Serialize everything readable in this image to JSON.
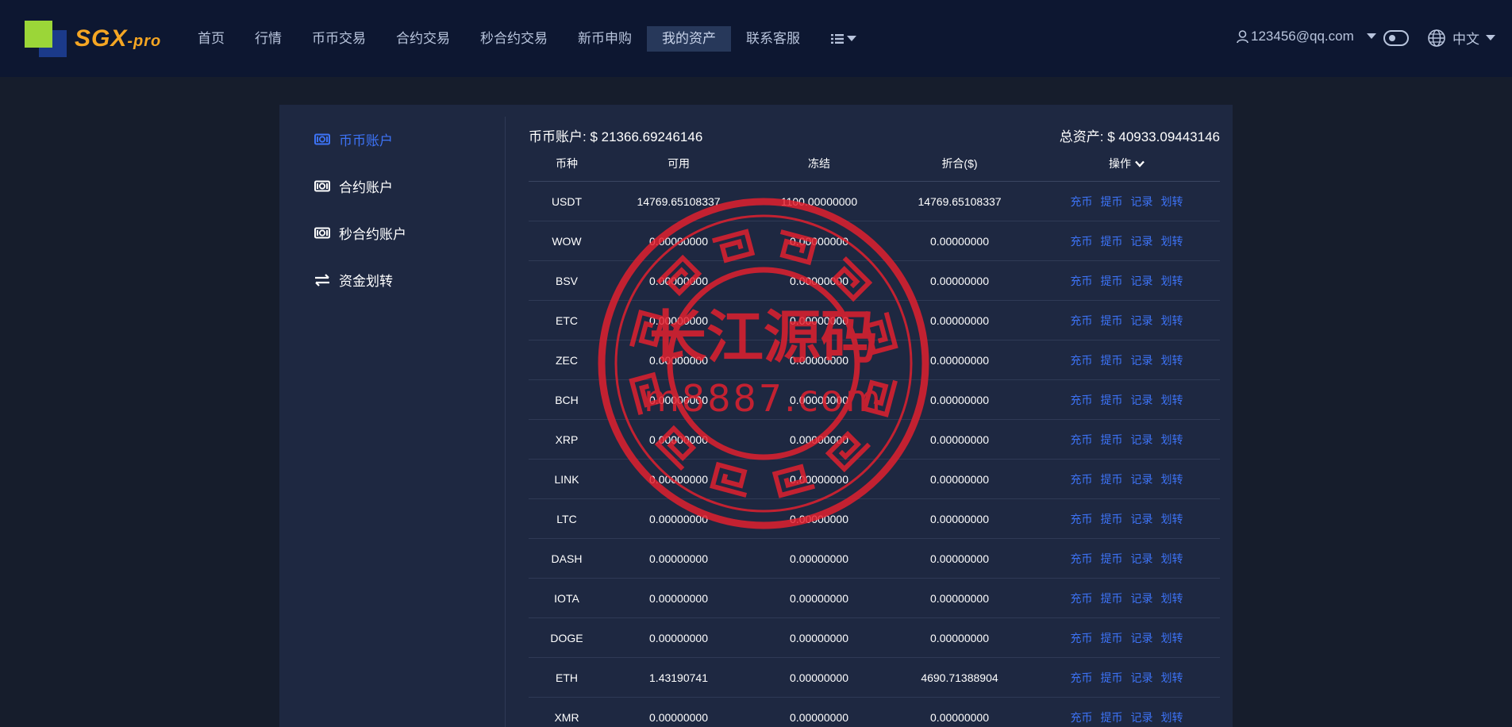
{
  "brand": {
    "logo_text": "SGX",
    "logo_suffix": "-pro"
  },
  "nav": [
    {
      "label": "首页"
    },
    {
      "label": "行情"
    },
    {
      "label": "币币交易"
    },
    {
      "label": "合约交易"
    },
    {
      "label": "秒合约交易"
    },
    {
      "label": "新币申购"
    },
    {
      "label": "我的资产",
      "active": true
    },
    {
      "label": "联系客服"
    }
  ],
  "header": {
    "user_email": "123456@qq.com",
    "language": "中文",
    "menu_icon": "list-icon",
    "theme_toggle_icon": "toggle-icon"
  },
  "sidebar": [
    {
      "label": "币币账户",
      "icon": "banknote-icon",
      "active": true
    },
    {
      "label": "合约账户",
      "icon": "banknote-icon"
    },
    {
      "label": "秒合约账户",
      "icon": "banknote-icon"
    },
    {
      "label": "资金划转",
      "icon": "transfer-icon"
    }
  ],
  "summary": {
    "coin_account_label": "币币账户:",
    "coin_account_value": "$ 21366.69246146",
    "total_label": "总资产:",
    "total_value": "$ 40933.09443146"
  },
  "table": {
    "headers": [
      "币种",
      "可用",
      "冻结",
      "折合($)",
      "操作"
    ],
    "actions": [
      "充币",
      "提币",
      "记录",
      "划转"
    ],
    "rows": [
      {
        "coin": "USDT",
        "available": "14769.65108337",
        "frozen": "1100.00000000",
        "value": "14769.65108337"
      },
      {
        "coin": "WOW",
        "available": "0.00000000",
        "frozen": "0.00000000",
        "value": "0.00000000"
      },
      {
        "coin": "BSV",
        "available": "0.00000000",
        "frozen": "0.00000000",
        "value": "0.00000000"
      },
      {
        "coin": "ETC",
        "available": "0.00000000",
        "frozen": "0.00000000",
        "value": "0.00000000"
      },
      {
        "coin": "ZEC",
        "available": "0.00000000",
        "frozen": "0.00000000",
        "value": "0.00000000"
      },
      {
        "coin": "BCH",
        "available": "0.00000000",
        "frozen": "0.00000000",
        "value": "0.00000000"
      },
      {
        "coin": "XRP",
        "available": "0.00000000",
        "frozen": "0.00000000",
        "value": "0.00000000"
      },
      {
        "coin": "LINK",
        "available": "0.00000000",
        "frozen": "0.00000000",
        "value": "0.00000000"
      },
      {
        "coin": "LTC",
        "available": "0.00000000",
        "frozen": "0.00000000",
        "value": "0.00000000"
      },
      {
        "coin": "DASH",
        "available": "0.00000000",
        "frozen": "0.00000000",
        "value": "0.00000000"
      },
      {
        "coin": "IOTA",
        "available": "0.00000000",
        "frozen": "0.00000000",
        "value": "0.00000000"
      },
      {
        "coin": "DOGE",
        "available": "0.00000000",
        "frozen": "0.00000000",
        "value": "0.00000000"
      },
      {
        "coin": "ETH",
        "available": "1.43190741",
        "frozen": "0.00000000",
        "value": "4690.71388904"
      },
      {
        "coin": "XMR",
        "available": "0.00000000",
        "frozen": "0.00000000",
        "value": "0.00000000"
      }
    ]
  },
  "watermark": {
    "title": "长江源码",
    "url": "m8887.com",
    "color": "#e8202e"
  }
}
